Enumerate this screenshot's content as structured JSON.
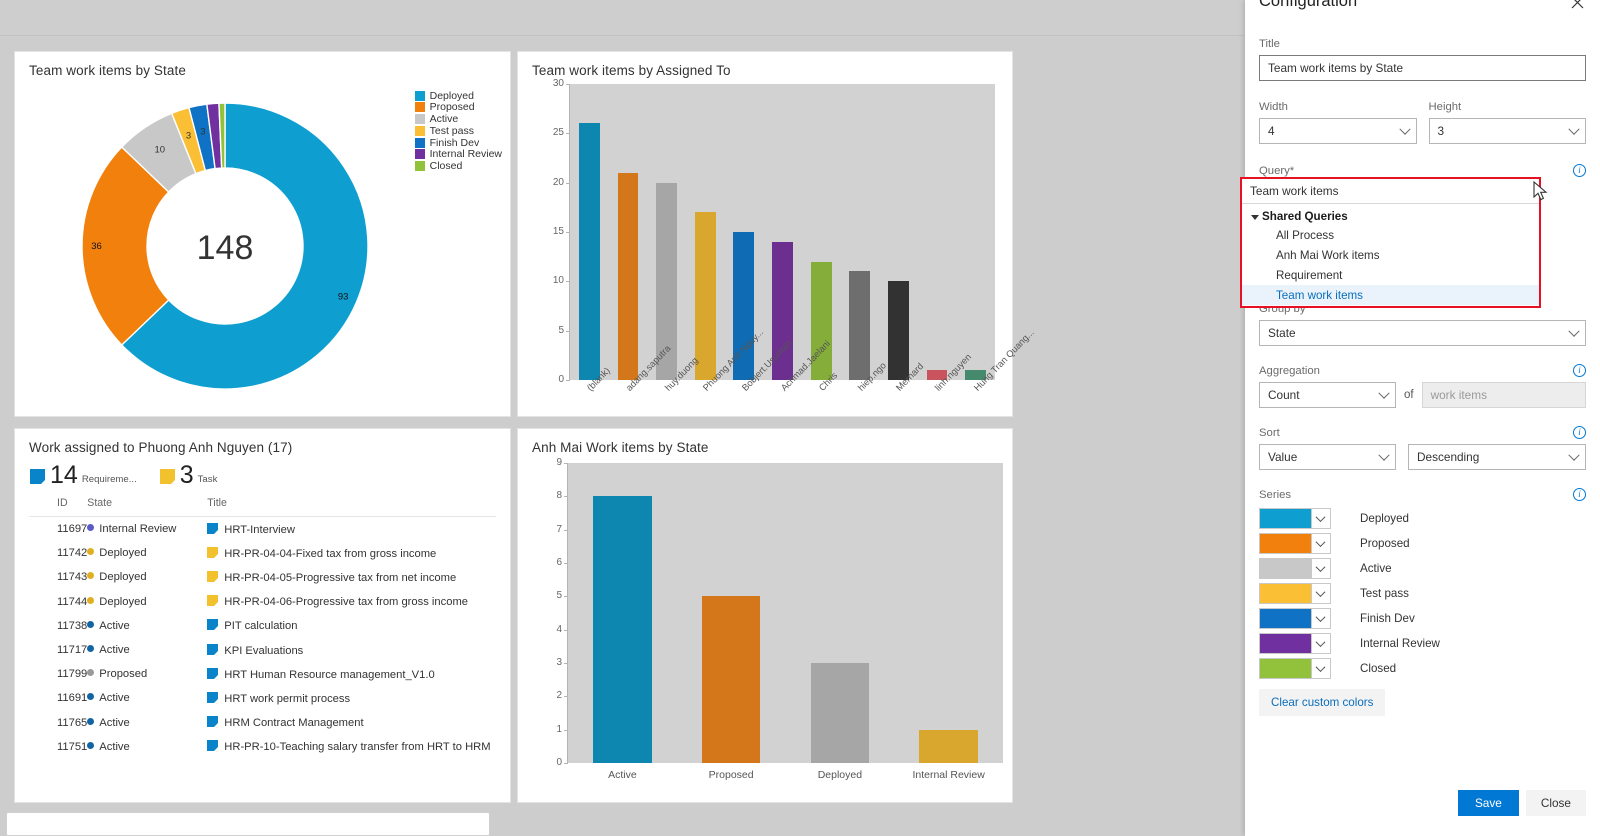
{
  "donut_tile": {
    "title": "Team work items by State",
    "center_value": "148"
  },
  "bar1_tile": {
    "title": "Team work items by Assigned To"
  },
  "bar2_tile": {
    "title": "Anh Mai Work items by State"
  },
  "list_tile": {
    "title": "Work assigned to Phuong Anh Nguyen (17)",
    "chips": [
      {
        "count": "14",
        "caption": "Requireme...",
        "icon": "requirement-icon",
        "color": "#0a84c8"
      },
      {
        "count": "3",
        "caption": "Task",
        "icon": "task-icon",
        "color": "#f2c12e"
      }
    ],
    "columns": [
      "ID",
      "State",
      "Title"
    ],
    "rows": [
      {
        "id": "11697",
        "state": "Internal Review",
        "state_color": "#5a5ac8",
        "title": "HRT-Interview",
        "icon": "requirement-icon",
        "icon_color": "#0a84c8"
      },
      {
        "id": "11742",
        "state": "Deployed",
        "state_color": "#e0b020",
        "title": "HR-PR-04-04-Fixed tax from gross income",
        "icon": "task-icon",
        "icon_color": "#f2c12e"
      },
      {
        "id": "11743",
        "state": "Deployed",
        "state_color": "#e0b020",
        "title": "HR-PR-04-05-Progressive tax from net income",
        "icon": "task-icon",
        "icon_color": "#f2c12e"
      },
      {
        "id": "11744",
        "state": "Deployed",
        "state_color": "#e0b020",
        "title": "HR-PR-04-06-Progressive tax from gross income",
        "icon": "task-icon",
        "icon_color": "#f2c12e"
      },
      {
        "id": "11738",
        "state": "Active",
        "state_color": "#1264a3",
        "title": "PIT calculation",
        "icon": "requirement-icon",
        "icon_color": "#0a84c8"
      },
      {
        "id": "11717",
        "state": "Active",
        "state_color": "#1264a3",
        "title": "KPI Evaluations",
        "icon": "requirement-icon",
        "icon_color": "#0a84c8"
      },
      {
        "id": "11799",
        "state": "Proposed",
        "state_color": "#9a9a9a",
        "title": "HRT Human Resource management_V1.0",
        "icon": "requirement-icon",
        "icon_color": "#0a84c8"
      },
      {
        "id": "11691",
        "state": "Active",
        "state_color": "#1264a3",
        "title": "HRT work permit process",
        "icon": "requirement-icon",
        "icon_color": "#0a84c8"
      },
      {
        "id": "11765",
        "state": "Active",
        "state_color": "#1264a3",
        "title": "HRM Contract Management",
        "icon": "requirement-icon",
        "icon_color": "#0a84c8"
      },
      {
        "id": "11751",
        "state": "Active",
        "state_color": "#1264a3",
        "title": "HR-PR-10-Teaching salary transfer from HRT to HRM",
        "icon": "requirement-icon",
        "icon_color": "#0a84c8"
      }
    ]
  },
  "panel": {
    "title": "Configuration",
    "close_icon": "close-icon",
    "title_label": "Title",
    "title_value": "Team work items by State",
    "width_label": "Width",
    "width_value": "4",
    "height_label": "Height",
    "height_value": "3",
    "query_label": "Query*",
    "query_value": "Team work items",
    "query_dropdown": {
      "group_label": "Shared Queries",
      "items": [
        {
          "label": "All Process",
          "selected": false
        },
        {
          "label": "Anh Mai Work items",
          "selected": false
        },
        {
          "label": "Requirement",
          "selected": false
        },
        {
          "label": "Team work items",
          "selected": true
        }
      ]
    },
    "groupby_label": "Group by",
    "groupby_value": "State",
    "aggregation_label": "Aggregation",
    "aggregation_value": "Count",
    "aggregation_of": "of",
    "aggregation_field_placeholder": "work items",
    "sort_label": "Sort",
    "sort_value": "Value",
    "sort_direction": "Descending",
    "series_label": "Series",
    "series": [
      {
        "label": "Deployed",
        "color": "#0e9fd0"
      },
      {
        "label": "Proposed",
        "color": "#f2800d"
      },
      {
        "label": "Active",
        "color": "#c8c8c8"
      },
      {
        "label": "Test pass",
        "color": "#fbbf35"
      },
      {
        "label": "Finish Dev",
        "color": "#0f72c4"
      },
      {
        "label": "Internal Review",
        "color": "#7030a0"
      },
      {
        "label": "Closed",
        "color": "#92c13c"
      }
    ],
    "clear_colors_label": "Clear custom colors",
    "save_label": "Save",
    "close_label": "Close",
    "accent_color": "#0078d4",
    "highlight_color": "#e81123"
  },
  "chart_data": [
    {
      "type": "pie",
      "title": "Team work items by State",
      "variant": "donut",
      "center_label": "148",
      "total": 148,
      "legend_position": "right",
      "categories": [
        "Deployed",
        "Proposed",
        "Active",
        "Test pass",
        "Finish Dev",
        "Internal Review",
        "Closed"
      ],
      "values": [
        93,
        36,
        10,
        3,
        3,
        2,
        1
      ],
      "colors": [
        "#0e9fd0",
        "#f2800d",
        "#c8c8c8",
        "#fbbf35",
        "#0f72c4",
        "#7030a0",
        "#92c13c"
      ],
      "labels_shown": [
        "93",
        "36",
        "10",
        "3",
        "3",
        "",
        ""
      ]
    },
    {
      "type": "bar",
      "title": "Team work items by Assigned To",
      "xlabel": "",
      "ylabel": "",
      "ylim": [
        0,
        30
      ],
      "yticks": [
        0,
        5,
        10,
        15,
        20,
        25,
        30
      ],
      "grid": false,
      "categories": [
        "(blank)",
        "adang.saputra",
        "huy.duong",
        "Phuong Anh Nguy...",
        "Bobjert.Usuman",
        "Achmad.Jaelani",
        "Chris",
        "hiep.ngo",
        "Mernard",
        "linh.nguyen",
        "Hung Tran Quang..."
      ],
      "values": [
        26,
        21,
        20,
        17,
        15,
        14,
        12,
        11,
        10,
        1,
        1
      ],
      "colors": [
        "#0e87b0",
        "#d4761a",
        "#a6a6a6",
        "#d9a62e",
        "#0f6cb4",
        "#6c2e8f",
        "#84ad3a",
        "#6e6e6e",
        "#323232",
        "#c9545e",
        "#468a6e"
      ]
    },
    {
      "type": "bar",
      "title": "Anh Mai Work items by State",
      "xlabel": "",
      "ylabel": "",
      "ylim": [
        0,
        9
      ],
      "yticks": [
        0,
        1,
        2,
        3,
        4,
        5,
        6,
        7,
        8,
        9
      ],
      "grid": false,
      "categories": [
        "Active",
        "Proposed",
        "Deployed",
        "Internal Review"
      ],
      "values": [
        8,
        5,
        3,
        1
      ],
      "colors": [
        "#0e87b0",
        "#d4761a",
        "#a6a6a6",
        "#d9a62e"
      ]
    }
  ]
}
